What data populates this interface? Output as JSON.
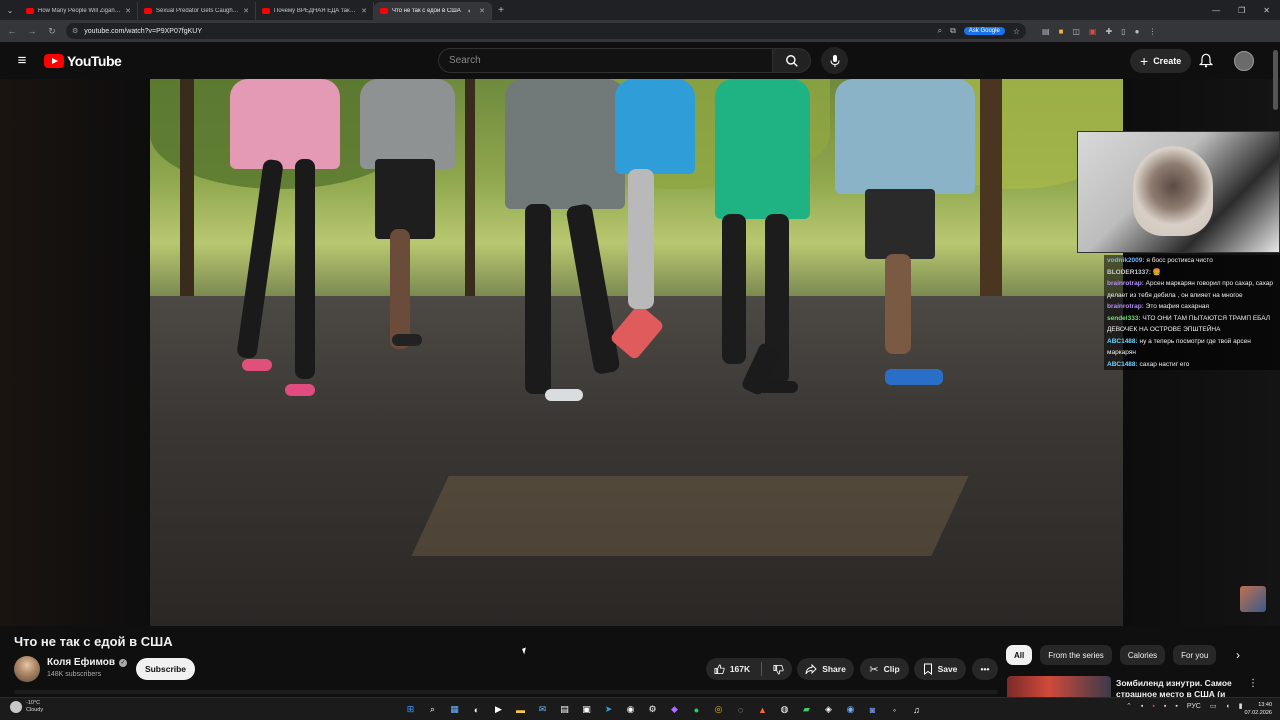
{
  "browser": {
    "tabs": [
      {
        "title": "How Many People Will Zigant...",
        "active": false
      },
      {
        "title": "Sexual Predator Gets Caught in...",
        "active": false
      },
      {
        "title": "Почему ВРЕДНАЯ ЕДА такая...",
        "active": false
      },
      {
        "title": "Что не так с едой в США",
        "active": true
      }
    ],
    "new_tab": "+",
    "url": "youtube.com/watch?v=P9XP07fgKUY",
    "ask_google": "Ask Google"
  },
  "youtube": {
    "logo_text": "YouTube",
    "search_placeholder": "Search",
    "create_label": "Create"
  },
  "stream_chat": [
    {
      "user": "vodnik2009:",
      "text": "я босс ростикса чисто",
      "color": "#6fb3ff"
    },
    {
      "user": "BLODER1337:",
      "text": "🍔",
      "color": "#c8c8c8"
    },
    {
      "user": "brainrotrap:",
      "text": "Арсен маркарян говорил про сахар, сахар делает из тебя дебила , он влияет на многое",
      "color": "#b58cff"
    },
    {
      "user": "brainrotrap:",
      "text": "Это мафия сахарная",
      "color": "#b58cff"
    },
    {
      "user": "sendel333:",
      "text": "ЧТО ОНИ ТАМ ПЫТАЮТСЯ ТРАМП ЕБАЛ ДЕВОЧЕК НА ОСТРОВЕ ЭПШТЕЙНА",
      "color": "#7ad87a"
    },
    {
      "user": "ABC1488:",
      "text": "ну а теперь посмотри где твой арсен маркарян",
      "color": "#6fd3ff"
    },
    {
      "user": "ABC1488:",
      "text": "сахар настиг его",
      "color": "#6fd3ff"
    }
  ],
  "video": {
    "title": "Что не так с едой в США",
    "channel_name": "Коля Ефимов",
    "subscribers": "148K subscribers",
    "subscribe_label": "Subscribe",
    "likes": "167K",
    "share_label": "Share",
    "clip_label": "Clip",
    "save_label": "Save"
  },
  "filters": {
    "chips": [
      "All",
      "From the series",
      "Calories",
      "For you"
    ],
    "active": "All"
  },
  "recommendation": {
    "title": "Зомбиленд изнутри. Самое страшное место в США (и в..."
  },
  "taskbar": {
    "temperature": "-10°C",
    "condition": "Cloudy",
    "language": "РУС",
    "time": "13:40",
    "date": "07.02.2026"
  }
}
